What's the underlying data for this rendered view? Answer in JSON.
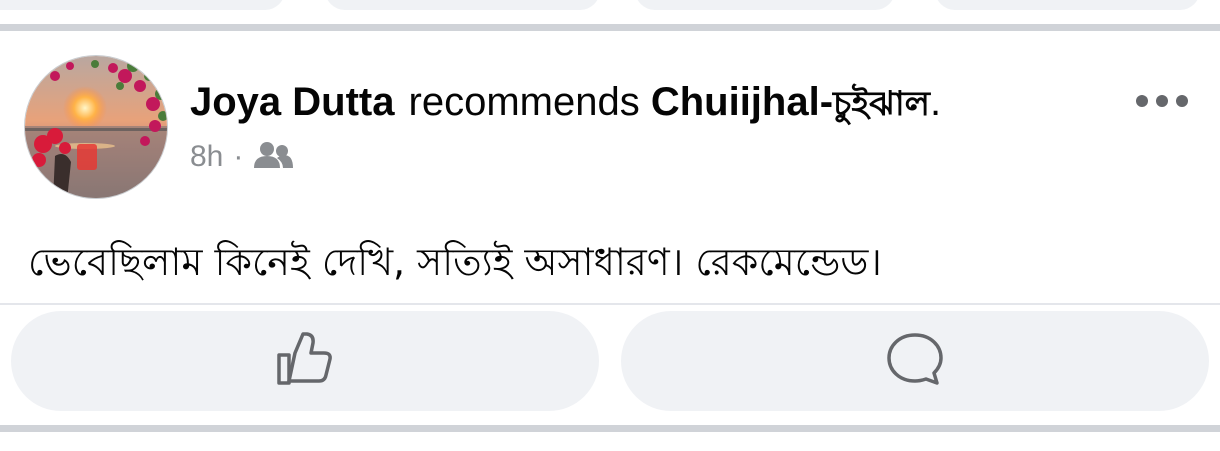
{
  "post": {
    "author": "Joya Dutta",
    "verb": "recommends",
    "page_name": "Chuiijhal-",
    "page_name_bengali": "চুইঝাল",
    "trailing": ".",
    "timestamp": "8h",
    "separator": "·",
    "audience_icon": "friends-icon",
    "body_text": "ভেবেছিলাম কিনেই দেখি, সত্যিই অসাধারণ। রেকমেন্ডেড।"
  },
  "actions": {
    "like_icon": "thumbs-up-icon",
    "comment_icon": "comment-icon"
  },
  "menu_icon": "more-options-icon",
  "colors": {
    "text": "#050505",
    "meta": "#8a8d91",
    "button_bg": "#f0f2f5",
    "divider": "#d0d3d8"
  }
}
